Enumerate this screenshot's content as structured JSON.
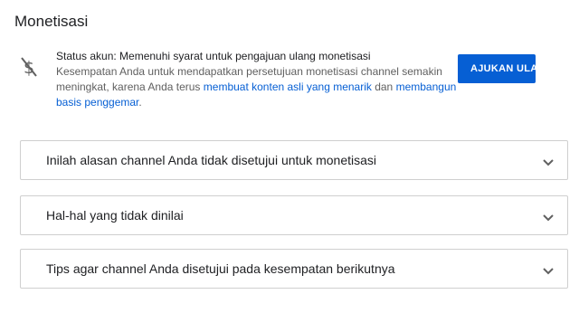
{
  "page": {
    "title": "Monetisasi"
  },
  "status": {
    "icon": "no-money-icon",
    "status_text": "Status akun: Memenuhi syarat untuk pengajuan ulang monetisasi",
    "desc_part1": "Kesempatan Anda untuk mendapatkan persetujuan monetisasi channel semakin meningkat, karena Anda terus ",
    "link1": "membuat konten asli yang menarik",
    "desc_part2": " dan ",
    "link2": "membangun basis penggemar",
    "desc_part3": ".",
    "button_label": "AJUKAN ULANG"
  },
  "panels": [
    {
      "label": "Inilah alasan channel Anda tidak disetujui untuk monetisasi",
      "icon": "chevron-down-icon"
    },
    {
      "label": "Hal-hal yang tidak dinilai",
      "icon": "chevron-down-icon"
    },
    {
      "label": "Tips agar channel Anda disetujui pada kesempatan berikutnya",
      "icon": "chevron-down-icon"
    }
  ],
  "colors": {
    "accent": "#065fd4",
    "link": "#065fd4",
    "border": "#cfcfcf",
    "secondary_text": "#606060"
  }
}
